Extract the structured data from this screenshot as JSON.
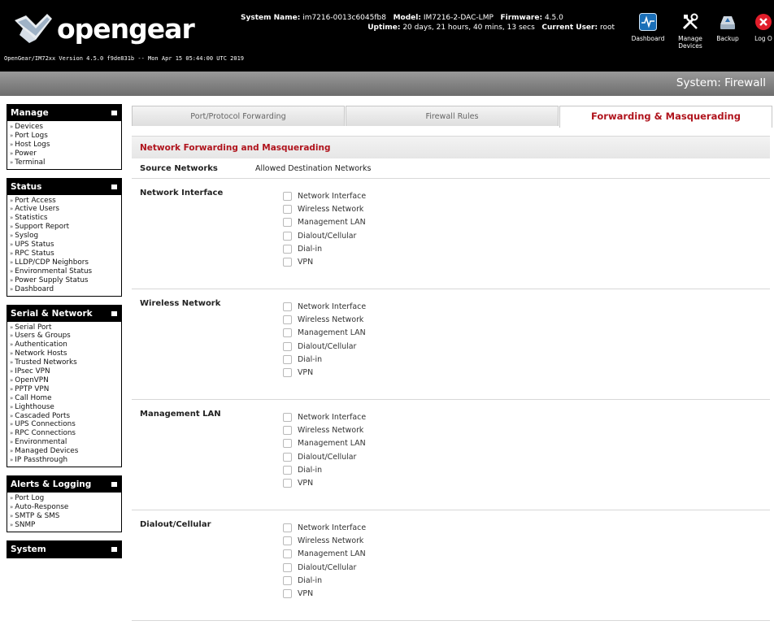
{
  "header": {
    "logo_text": "opengear",
    "version_line": "OpenGear/IM72xx Version 4.5.0 f9de831b -- Mon Apr 15 05:44:00 UTC 2019",
    "system_name_label": "System Name:",
    "system_name": "im7216-0013c6045fb8",
    "model_label": "Model:",
    "model": "IM7216-2-DAC-LMP",
    "firmware_label": "Firmware:",
    "firmware": "4.5.0",
    "uptime_label": "Uptime:",
    "uptime": "20 days, 21 hours, 40 mins, 13 secs",
    "current_user_label": "Current User:",
    "current_user": "root",
    "icons": {
      "dashboard": "Dashboard",
      "manage_devices_1": "Manage",
      "manage_devices_2": "Devices",
      "backup": "Backup",
      "logout": "Log O"
    },
    "colors": {
      "logo_accent": "#d5dde6",
      "logout_red": "#e11d2a"
    }
  },
  "page_title": "System: Firewall",
  "sidebar": [
    {
      "title": "Manage",
      "items": [
        "Devices",
        "Port Logs",
        "Host Logs",
        "Power",
        "Terminal"
      ]
    },
    {
      "title": "Status",
      "items": [
        "Port Access",
        "Active Users",
        "Statistics",
        "Support Report",
        "Syslog",
        "UPS Status",
        "RPC Status",
        "LLDP/CDP Neighbors",
        "Environmental Status",
        "Power Supply Status",
        "Dashboard"
      ]
    },
    {
      "title": "Serial & Network",
      "items": [
        "Serial Port",
        "Users & Groups",
        "Authentication",
        "Network Hosts",
        "Trusted Networks",
        "IPsec VPN",
        "OpenVPN",
        "PPTP VPN",
        "Call Home",
        "Lighthouse",
        "Cascaded Ports",
        "UPS Connections",
        "RPC Connections",
        "Environmental",
        "Managed Devices",
        "IP Passthrough"
      ]
    },
    {
      "title": "Alerts & Logging",
      "items": [
        "Port Log",
        "Auto-Response",
        "SMTP & SMS",
        "SNMP"
      ]
    },
    {
      "title": "System",
      "items": []
    }
  ],
  "tabs": [
    {
      "label": "Port/Protocol Forwarding",
      "active": false
    },
    {
      "label": "Firewall Rules",
      "active": false
    },
    {
      "label": "Forwarding & Masquerading",
      "active": true
    }
  ],
  "section_title": "Network Forwarding and Masquerading",
  "columns": {
    "source": "Source Networks",
    "destination": "Allowed Destination Networks"
  },
  "groups": [
    {
      "source": "Network Interface",
      "options": [
        "Network Interface",
        "Wireless Network",
        "Management LAN",
        "Dialout/Cellular",
        "Dial-in",
        "VPN"
      ]
    },
    {
      "source": "Wireless Network",
      "options": [
        "Network Interface",
        "Wireless Network",
        "Management LAN",
        "Dialout/Cellular",
        "Dial-in",
        "VPN"
      ]
    },
    {
      "source": "Management LAN",
      "options": [
        "Network Interface",
        "Wireless Network",
        "Management LAN",
        "Dialout/Cellular",
        "Dial-in",
        "VPN"
      ]
    },
    {
      "source": "Dialout/Cellular",
      "options": [
        "Network Interface",
        "Wireless Network",
        "Management LAN",
        "Dialout/Cellular",
        "Dial-in",
        "VPN"
      ]
    }
  ],
  "colors": {
    "accent_red": "#b0141d",
    "header_bg": "#000000",
    "panel_head_bg": "#000000"
  }
}
